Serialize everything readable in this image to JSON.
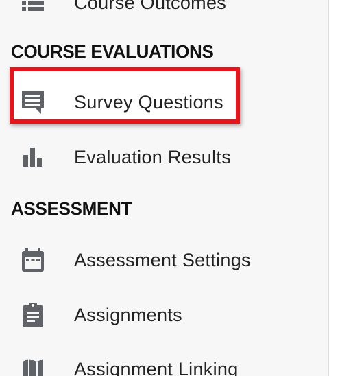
{
  "sidebar": {
    "top_item": {
      "label": "Course Outcomes",
      "icon": "list-icon"
    },
    "sections": [
      {
        "title": "COURSE EVALUATIONS",
        "items": [
          {
            "label": "Survey Questions",
            "icon": "comment-icon",
            "highlighted": true
          },
          {
            "label": "Evaluation Results",
            "icon": "bar-chart-icon"
          }
        ]
      },
      {
        "title": "ASSESSMENT",
        "items": [
          {
            "label": "Assessment Settings",
            "icon": "calendar-icon"
          },
          {
            "label": "Assignments",
            "icon": "clipboard-icon"
          },
          {
            "label": "Assignment Linking",
            "icon": "map-icon"
          }
        ]
      }
    ]
  },
  "colors": {
    "highlight_border": "#e8141c",
    "icon": "#5f6368",
    "sidebar_bg": "#f7f7f7"
  }
}
